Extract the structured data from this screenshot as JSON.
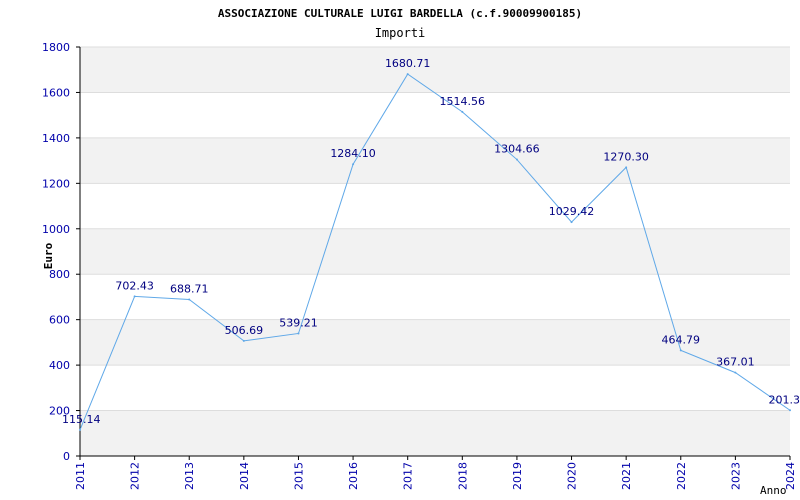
{
  "chart_data": {
    "type": "line",
    "title": "ASSOCIAZIONE CULTURALE LUIGI BARDELLA (c.f.90009900185)",
    "subtitle": "Importi",
    "xlabel": "Anno",
    "ylabel": "Euro",
    "x": [
      2011,
      2012,
      2013,
      2014,
      2015,
      2016,
      2017,
      2018,
      2019,
      2020,
      2021,
      2022,
      2023,
      2024
    ],
    "x_tick_labels": [
      "2011",
      "2012",
      "2013",
      "2014",
      "2015",
      "2016",
      "2017",
      "2018",
      "2019",
      "2020",
      "2021",
      "2022",
      "2023",
      "2024"
    ],
    "values": [
      115.14,
      702.43,
      688.71,
      506.69,
      539.21,
      1284.1,
      1680.71,
      1514.56,
      1304.66,
      1029.42,
      1270.3,
      464.79,
      367.01,
      201.3
    ],
    "data_labels": [
      "115.14",
      "702.43",
      "688.71",
      "506.69",
      "539.21",
      "1284.10",
      "1680.71",
      "1514.56",
      "1304.66",
      "1029.42",
      "1270.30",
      "464.79",
      "367.01",
      "201.3"
    ],
    "y_ticks": [
      0,
      200,
      400,
      600,
      800,
      1000,
      1200,
      1400,
      1600,
      1800
    ],
    "y_tick_labels": [
      "0",
      "200",
      "400",
      "600",
      "800",
      "1000",
      "1200",
      "1400",
      "1600",
      "1800"
    ],
    "ylim": [
      0,
      1800
    ],
    "grid": true,
    "colors": {
      "line": "#5fa8e8",
      "band": "#f2f2f2",
      "axis": "#000000",
      "tick_labels": "#0000aa",
      "data_labels": "#000080",
      "title": "#000000"
    }
  }
}
